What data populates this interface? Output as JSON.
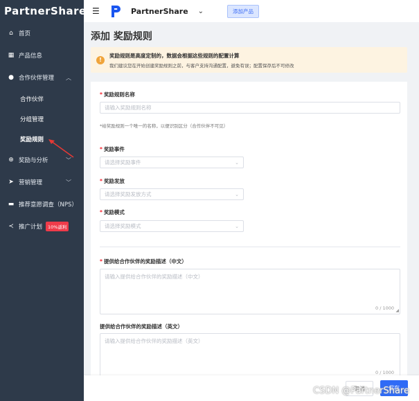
{
  "sidebar": {
    "logo": "PartnerShare",
    "items": [
      {
        "label": "首页",
        "icon": "home-icon"
      },
      {
        "label": "产品信息",
        "icon": "grid-icon"
      },
      {
        "label": "合作伙伴管理",
        "icon": "user-icon",
        "expanded": true
      },
      {
        "label": "合作伙伴",
        "sub": true
      },
      {
        "label": "分组管理",
        "sub": true
      },
      {
        "label": "奖励规则",
        "sub": true,
        "active": true
      },
      {
        "label": "奖励与分析",
        "icon": "plus-circle-icon"
      },
      {
        "label": "营销管理",
        "icon": "send-icon"
      },
      {
        "label": "推荐意愿调查（NPS）",
        "icon": "chat-icon"
      },
      {
        "label": "推广计划",
        "icon": "share-icon",
        "badge": "10%返利"
      }
    ]
  },
  "topbar": {
    "app_name": "PartnerShare",
    "add_product": "添加产品"
  },
  "main": {
    "title": "添加 奖励规则",
    "notice": {
      "title": "奖励规则是高度定制的，数据会根据这些规则的配置计算",
      "desc": "我们建议您在开始创建奖励规则之前，与客户支持沟通配置，避免有误；配置保存后不可修改"
    },
    "form": {
      "name_label": "奖励规则名称",
      "name_placeholder": "请输入奖励规则名称",
      "name_hint": "*给奖励规则一个唯一的名称，以便识别区分（合作伙伴不可见）",
      "event_label": "奖励事件",
      "event_placeholder": "请选择奖励事件",
      "payout_label": "奖励发放",
      "payout_placeholder": "请选择奖励发放方式",
      "mode_label": "奖励模式",
      "mode_placeholder": "请选择奖励模式",
      "desc_cn_label": "提供给合作伙伴的奖励描述（中文）",
      "desc_cn_placeholder": "请输入提供给合作伙伴的奖励描述（中文）",
      "desc_cn_counter": "0 / 1000",
      "desc_en_label": "提供给合作伙伴的奖励描述（英文）",
      "desc_en_placeholder": "请输入提供给合作伙伴的奖励描述（英文）",
      "desc_en_counter": "0 / 1000"
    }
  },
  "footer": {
    "cancel": "取消",
    "save": "保存",
    "watermark": "CSDN @PartnerShare"
  },
  "colors": {
    "sidebar_bg": "#2e3a4a",
    "primary": "#2f6bf6",
    "required": "#f5222d",
    "notice_bg": "#fdf3e1",
    "badge": "#ef3b4a"
  }
}
